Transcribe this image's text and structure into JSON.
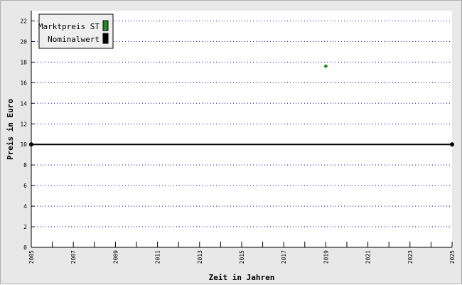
{
  "chart_data": {
    "type": "scatter",
    "xlabel": "Zeit in Jahren",
    "ylabel": "Preis in Euro",
    "xlim": [
      2005,
      2025
    ],
    "ylim": [
      0,
      23
    ],
    "x_ticks": [
      2005,
      2007,
      2009,
      2011,
      2013,
      2015,
      2017,
      2019,
      2021,
      2023,
      2025
    ],
    "y_ticks": [
      0,
      2,
      4,
      6,
      8,
      10,
      12,
      14,
      16,
      18,
      20,
      22
    ],
    "grid": true,
    "legend_position": "top-left",
    "series": [
      {
        "name": "Marktpreis ST",
        "kind": "point",
        "color": "#228b22",
        "points": [
          {
            "x": 2019,
            "y": 17.6
          }
        ]
      },
      {
        "name": "Nominalwert",
        "kind": "line",
        "color": "#000000",
        "points": [
          {
            "x": 2005,
            "y": 10
          },
          {
            "x": 2025,
            "y": 10
          }
        ]
      }
    ]
  }
}
